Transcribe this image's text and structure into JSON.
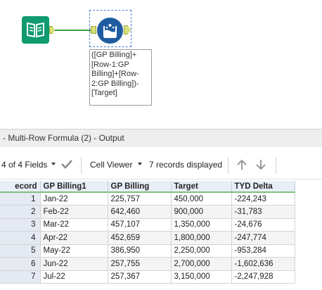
{
  "workflow": {
    "input_tool_icon": "book-icon",
    "formula_tool_icon": "multi-row-formula-icon",
    "annotation": "([GP Billing]+\n[Row-1:GP\nBilling]+[Row-\n2:GP Billing])-\n[Target]"
  },
  "results": {
    "title": "- Multi-Row Formula (2) - Output",
    "fields_selector": "4 of 4 Fields",
    "cell_viewer": "Cell Viewer",
    "records_displayed": "7 records displayed",
    "columns": [
      "ecord",
      "GP Billing1",
      "GP Billing",
      "Target",
      "TYD Delta"
    ],
    "rows": [
      {
        "record": "1",
        "gp_billing1": "Jan-22",
        "gp_billing": "225,757",
        "target": "450,000",
        "tyd_delta": "-224,243"
      },
      {
        "record": "2",
        "gp_billing1": "Feb-22",
        "gp_billing": "642,460",
        "target": "900,000",
        "tyd_delta": "-31,783"
      },
      {
        "record": "3",
        "gp_billing1": "Mar-22",
        "gp_billing": "457,107",
        "target": "1,350,000",
        "tyd_delta": "-24,676"
      },
      {
        "record": "4",
        "gp_billing1": "Apr-22",
        "gp_billing": "452,659",
        "target": "1,800,000",
        "tyd_delta": "-247,774"
      },
      {
        "record": "5",
        "gp_billing1": "May-22",
        "gp_billing": "386,950",
        "target": "2,250,000",
        "tyd_delta": "-953,284"
      },
      {
        "record": "6",
        "gp_billing1": "Jun-22",
        "gp_billing": "257,755",
        "target": "2,700,000",
        "tyd_delta": "-1,602,636"
      },
      {
        "record": "7",
        "gp_billing1": "Jul-22",
        "gp_billing": "257,367",
        "target": "3,150,000",
        "tyd_delta": "-2,247,928"
      }
    ]
  },
  "colors": {
    "input_tool": "#0f9a6f",
    "formula_tool": "#1f5da0",
    "connector": "#3c9f3c",
    "anchor": "#d7e07a",
    "header_underline": "#7fc07f"
  }
}
